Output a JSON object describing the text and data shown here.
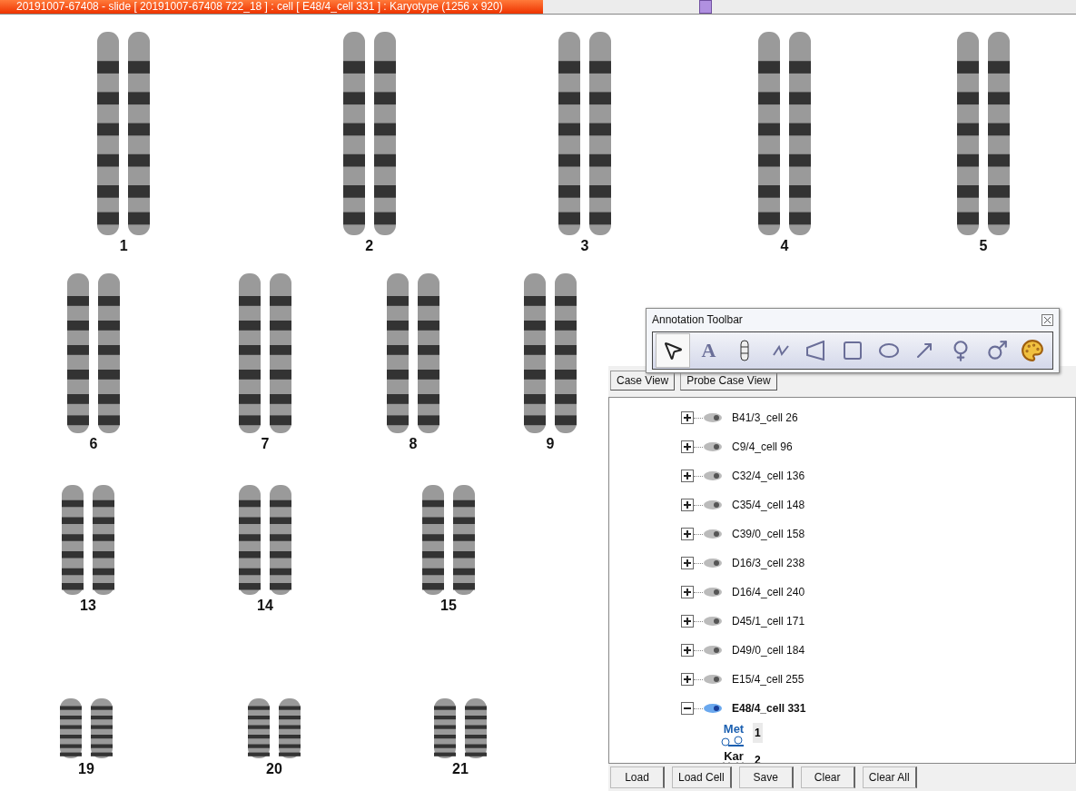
{
  "window": {
    "title": "20191007-67408 - slide [ 20191007-67408 722_18 ] : cell [ E48/4_cell 331 ] : Karyotype  (1256 x 920)"
  },
  "karyotype": {
    "rows": [
      {
        "pairs": [
          "1",
          "2",
          "3",
          "4",
          "5"
        ]
      },
      {
        "pairs": [
          "6",
          "7",
          "8",
          "9"
        ]
      },
      {
        "pairs": [
          "13",
          "14",
          "15"
        ]
      },
      {
        "pairs": [
          "19",
          "20",
          "21"
        ]
      }
    ]
  },
  "annotation_toolbar": {
    "title": "Annotation Toolbar",
    "tools": [
      {
        "kind": "pointer",
        "selected": true
      },
      {
        "kind": "text",
        "glyph": "A",
        "selected": false
      },
      {
        "kind": "chromosome",
        "selected": false
      },
      {
        "kind": "freehand",
        "selected": false
      },
      {
        "kind": "polygon",
        "selected": false
      },
      {
        "kind": "rectangle",
        "selected": false
      },
      {
        "kind": "ellipse",
        "selected": false
      },
      {
        "kind": "arrow",
        "selected": false
      },
      {
        "kind": "female",
        "selected": false
      },
      {
        "kind": "male",
        "selected": false
      },
      {
        "kind": "palette",
        "selected": false
      }
    ]
  },
  "case_panel": {
    "views": [
      "Case View",
      "Probe Case View"
    ],
    "tree": [
      {
        "label": "B41/3_cell 26",
        "expanded": false,
        "selected": false
      },
      {
        "label": "C9/4_cell 96",
        "expanded": false,
        "selected": false
      },
      {
        "label": "C32/4_cell 136",
        "expanded": false,
        "selected": false
      },
      {
        "label": "C35/4_cell 148",
        "expanded": false,
        "selected": false
      },
      {
        "label": "C39/0_cell 158",
        "expanded": false,
        "selected": false
      },
      {
        "label": "D16/3_cell 238",
        "expanded": false,
        "selected": false
      },
      {
        "label": "D16/4_cell 240",
        "expanded": false,
        "selected": false
      },
      {
        "label": "D45/1_cell 171",
        "expanded": false,
        "selected": false
      },
      {
        "label": "D49/0_cell 184",
        "expanded": false,
        "selected": false
      },
      {
        "label": "E15/4_cell 255",
        "expanded": false,
        "selected": false
      },
      {
        "label": "E48/4_cell 331",
        "expanded": true,
        "selected": true,
        "children": [
          {
            "kind": "metaphase",
            "tag": "Met",
            "number": "1",
            "selected": true
          },
          {
            "kind": "karyotype",
            "tag": "Kar",
            "number": "2",
            "selected": false
          }
        ]
      }
    ],
    "buttons": [
      "Load",
      "Load Cell",
      "Save",
      "Clear",
      "Clear All"
    ]
  }
}
